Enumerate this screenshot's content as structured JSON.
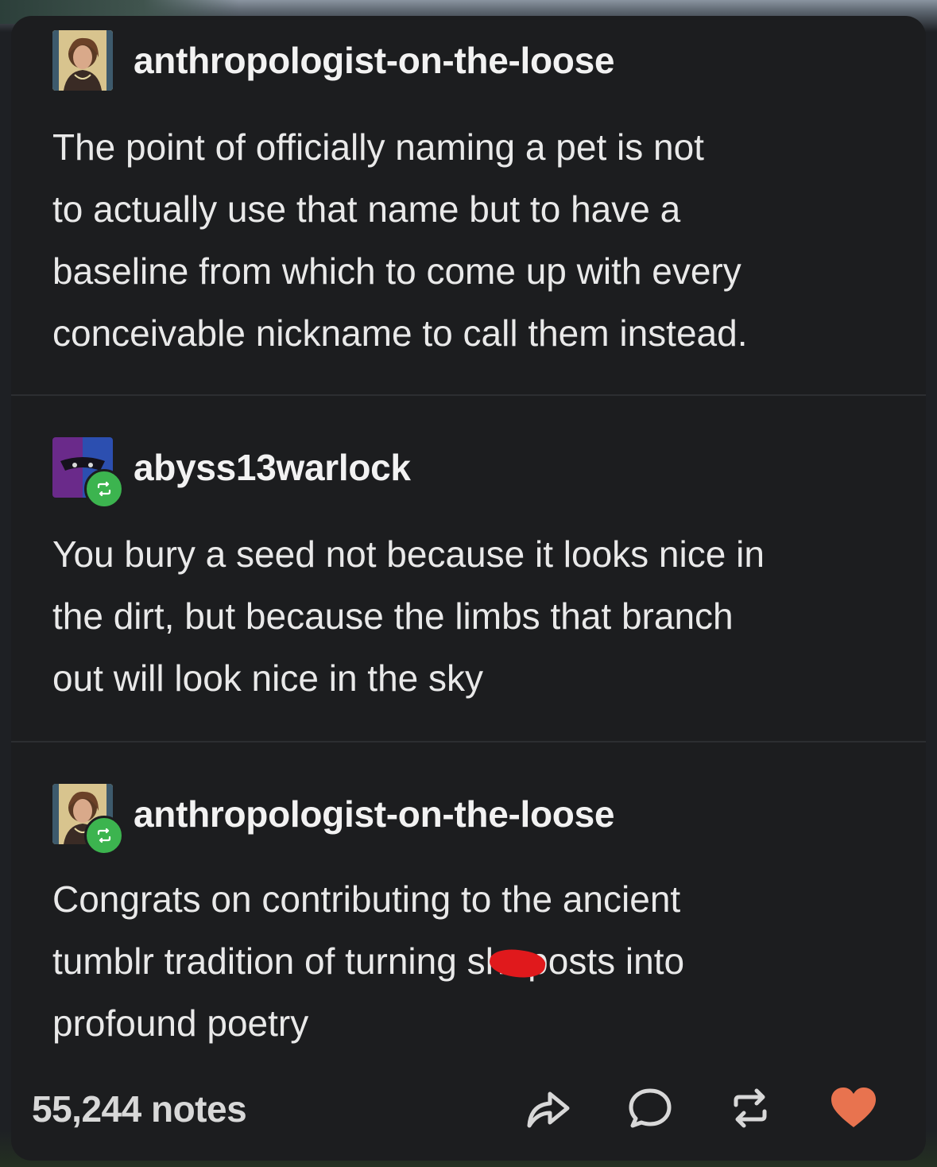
{
  "posts": [
    {
      "username": "anthropologist-on-the-loose",
      "avatar_icon": "portrait-avatar-icon",
      "is_reblog": false,
      "text": "The point of officially naming a pet is not\nto actually use that name but to have a\nbaseline from which to come up with every\nconceivable nickname to call them instead."
    },
    {
      "username": "abyss13warlock",
      "avatar_icon": "masked-face-avatar-icon",
      "is_reblog": true,
      "text": "You bury a seed not because it looks nice in\nthe dirt, but because the limbs that branch\nout will look nice in the sky"
    },
    {
      "username": "anthropologist-on-the-loose",
      "avatar_icon": "portrait-avatar-icon",
      "is_reblog": true,
      "text_before_redaction": "Congrats on contributing to the ancient\ntumblr tradition of turning sh",
      "text_after_redaction": "posts into\nprofound poetry"
    }
  ],
  "footer": {
    "notes_label": "55,244 notes",
    "actions": [
      {
        "name": "share",
        "icon": "share-arrow-icon"
      },
      {
        "name": "reply",
        "icon": "speech-bubble-icon"
      },
      {
        "name": "reblog",
        "icon": "reblog-icon"
      },
      {
        "name": "like",
        "icon": "heart-icon",
        "color": "#e8734f"
      }
    ]
  },
  "colors": {
    "background": "#1c1d1f",
    "text": "#e9e9e9",
    "reblog_badge": "#3cb44f",
    "like": "#e8734f",
    "redaction": "#e0191c"
  }
}
